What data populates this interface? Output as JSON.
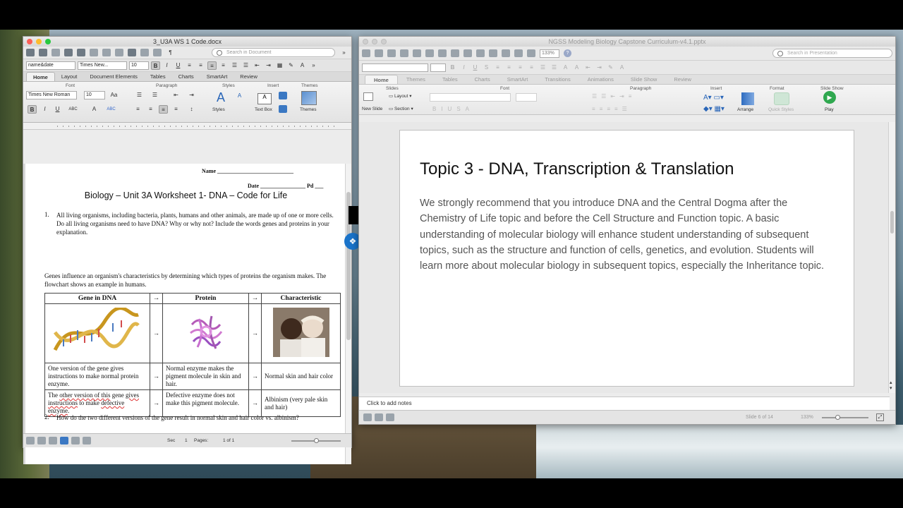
{
  "word": {
    "title": "3_U3A WS 1 Code.docx",
    "search_placeholder": "Search in Document",
    "style_select": "name&date",
    "font_select": "Times New...",
    "size_select": "10",
    "tabs": [
      "Home",
      "Layout",
      "Document Elements",
      "Tables",
      "Charts",
      "SmartArt",
      "Review"
    ],
    "ribbon_groups": {
      "font": "Font",
      "paragraph": "Paragraph",
      "styles": "Styles",
      "insert": "Insert",
      "themes": "Themes"
    },
    "ribbon_font": "Times New Roman",
    "ribbon_size": "10",
    "ribbon_labels": {
      "styles": "Styles",
      "text_box": "Text Box",
      "themes": "Themes"
    },
    "doc": {
      "name_label": "Name",
      "date_label": "Date",
      "pd_label": "Pd",
      "heading": "Biology – Unit 3A Worksheet 1- DNA – Code for Life",
      "q1_num": "1.",
      "q1": "All living organisms, including bacteria, plants, humans and other animals, are made up of one or more cells. Do all living organisms need to have DNA? Why or why not? Include the words genes and proteins in your explanation.",
      "intro": "Genes influence an organism's characteristics by determining which types of proteins the organism makes. The flowchart shows an example in humans.",
      "table_headers": [
        "Gene in DNA",
        "→",
        "Protein",
        "→",
        "Characteristic"
      ],
      "arrow": "→",
      "row2": [
        "One version of the gene gives instructions to make normal protein enzyme.",
        "Normal enzyme makes the pigment molecule in skin and hair.",
        "Normal skin and hair color"
      ],
      "row3_gene_a": "The ",
      "row3_gene_b": "other version of this",
      "row3_gene_c": " gene ",
      "row3_gene_d": "gives instructions",
      "row3_gene_e": " to make ",
      "row3_gene_f": "defective enzyme",
      "row3_gene_g": ".",
      "row3": [
        "Defective enzyme does not make this pigment molecule.",
        "Albinism (very pale skin and hair)"
      ],
      "q2_num": "2.",
      "q2": "How do the two different versions of the gene result in normal skin and hair color vs. albinism?"
    },
    "status": {
      "sec_label": "Sec",
      "sec_value": "1",
      "pages_label": "Pages:",
      "pages_value": "1 of 1"
    }
  },
  "ppt": {
    "title": "NGSS Modeling Biology Capstone Curriculum-v4.1.pptx",
    "zoom": "133%",
    "search_placeholder": "Search in Presentation",
    "tabs": [
      "Home",
      "Themes",
      "Tables",
      "Charts",
      "SmartArt",
      "Transitions",
      "Animations",
      "Slide Show",
      "Review"
    ],
    "ribbon_groups": {
      "slides": "Slides",
      "font": "Font",
      "paragraph": "Paragraph",
      "insert": "Insert",
      "format": "Format",
      "slideshow": "Slide Show"
    },
    "ribbon_labels": {
      "new_slide": "New Slide",
      "layout": "Layout",
      "section": "Section",
      "arrange": "Arrange",
      "quick_styles": "Quick Styles",
      "play": "Play"
    },
    "slide": {
      "title": "Topic 3 - DNA, Transcription & Translation",
      "body": "We strongly recommend that you introduce DNA and the Central Dogma after the Chemistry of Life topic and before the Cell Structure and Function topic. A basic understanding of molecular biology will enhance student understanding of subsequent topics, such as the structure and function of cells, genetics, and evolution. Students will learn more about molecular biology in subsequent topics, especially the Inheritance topic."
    },
    "notes_placeholder": "Click to add notes",
    "status": {
      "slide_indicator": "Slide 6 of 14",
      "zoom": "133%"
    }
  },
  "colors": {
    "accent_blue": "#1a73c9",
    "traffic_red": "#fc5f57",
    "traffic_yellow": "#fdbc2e",
    "traffic_green": "#28c840",
    "play_green": "#2fa84f"
  }
}
